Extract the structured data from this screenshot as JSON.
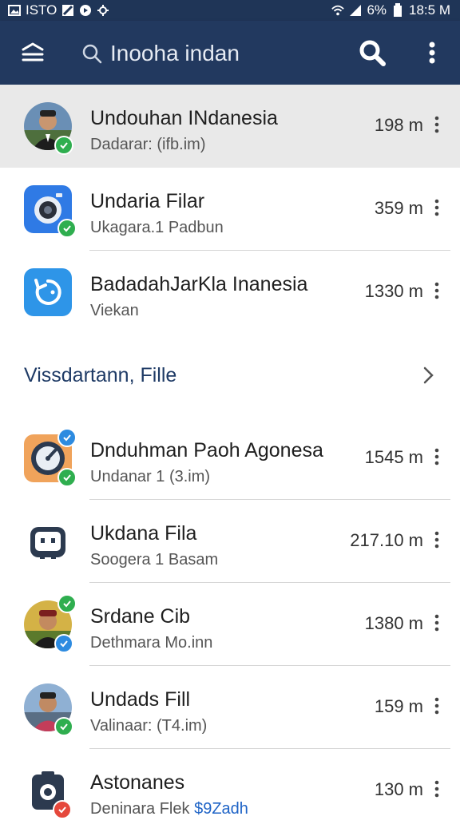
{
  "status_bar": {
    "left_text": "ISTO",
    "battery": "6%",
    "time": "18:5 M"
  },
  "app_bar": {
    "search_text": "Inooha indan",
    "icons": [
      "menu-icon",
      "search-icon",
      "more-vert-icon"
    ]
  },
  "items": [
    {
      "title": "Undouhan INdanesia",
      "subtitle": "Dadarar: (ifb.im)",
      "size": "198 m",
      "icon": "avatar-man-glasses",
      "badge": "green-check"
    },
    {
      "title": "Undaria Filar",
      "subtitle": "Ukagara.1 Padbun",
      "size": "359 m",
      "icon": "camera-app-icon",
      "badge": "green-check"
    },
    {
      "title": "BadadahJarKla Inanesia",
      "subtitle": "Viekan",
      "size": "1330 m",
      "icon": "refresh-app-icon",
      "badge": ""
    }
  ],
  "section": {
    "title": "Vissdartann, Fille"
  },
  "items2": [
    {
      "title": "Dnduhman Paoh Agonesa",
      "subtitle": "Undanar 1 (3.im)",
      "size": "1545 m",
      "icon": "gauge-app-icon",
      "badge": "green-check"
    },
    {
      "title": "Ukdana Fila",
      "subtitle": "Soogera 1 Basam",
      "size": "217.10 m",
      "icon": "robot-app-icon",
      "badge": ""
    },
    {
      "title": "Srdane Cib",
      "subtitle": "Dethmara Mo.inn",
      "size": "1380 m",
      "icon": "avatar-man-cap",
      "badge": "blue-check"
    },
    {
      "title": "Undads Fill",
      "subtitle": "Valinaar: (T4.im)",
      "size": "159 m",
      "icon": "avatar-man-red",
      "badge": "green-check"
    },
    {
      "title": "Astonanes",
      "subtitle": "Deninara Flek",
      "subtitle_accent": "$9Zadh",
      "size": "130 m",
      "icon": "camera-dark-icon",
      "badge": "red-check"
    }
  ],
  "colors": {
    "appbar": "#22395f",
    "accent": "#1e63c6",
    "green_badge": "#2fae4f",
    "blue_badge": "#2d8be0",
    "red_badge": "#e5483c"
  }
}
